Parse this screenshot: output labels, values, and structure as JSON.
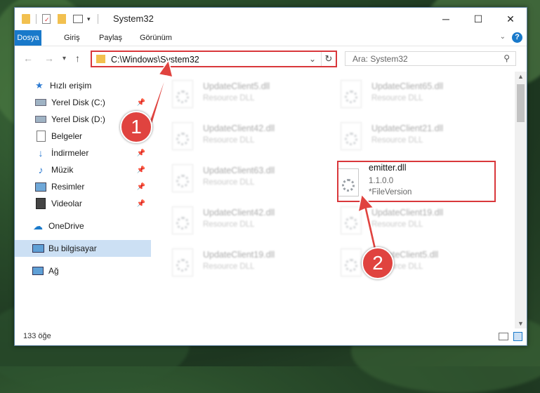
{
  "window": {
    "title": "System32",
    "minimize_label": "─",
    "maximize_label": "☐",
    "close_label": "✕"
  },
  "ribbon": {
    "tabs": [
      "Dosya",
      "Giriş",
      "Paylaş",
      "Görünüm"
    ]
  },
  "nav": {
    "address": "C:\\Windows\\System32",
    "search_placeholder": "Ara: System32"
  },
  "sidebar": {
    "items": [
      {
        "label": "Hızlı erişim",
        "icon": "star-icon",
        "pinned": false
      },
      {
        "label": "Yerel Disk (C:)",
        "icon": "drive-icon",
        "pinned": true
      },
      {
        "label": "Yerel Disk (D:)",
        "icon": "drive-icon",
        "pinned": true
      },
      {
        "label": "Belgeler",
        "icon": "documents-icon",
        "pinned": true
      },
      {
        "label": "İndirmeler",
        "icon": "download-icon",
        "pinned": true
      },
      {
        "label": "Müzik",
        "icon": "music-icon",
        "pinned": true
      },
      {
        "label": "Resimler",
        "icon": "pictures-icon",
        "pinned": true
      },
      {
        "label": "Videolar",
        "icon": "videos-icon",
        "pinned": true
      },
      {
        "label": "OneDrive",
        "icon": "cloud-icon",
        "pinned": false
      },
      {
        "label": "Bu bilgisayar",
        "icon": "computer-icon",
        "pinned": false,
        "selected": true
      },
      {
        "label": "Ağ",
        "icon": "network-icon",
        "pinned": false
      }
    ]
  },
  "files": [
    {
      "name": "UpdateClient5.dll",
      "type": "Resource DLL"
    },
    {
      "name": "UpdateClient65.dll",
      "type": "Resource DLL"
    },
    {
      "name": "UpdateClient42.dll",
      "type": "Resource DLL"
    },
    {
      "name": "UpdateClient21.dll",
      "type": "Resource DLL"
    },
    {
      "name": "UpdateClient63.dll",
      "type": "Resource DLL"
    },
    {
      "name": "emitter.dll",
      "version": "1.1.0.0",
      "description": "*FileVersion"
    },
    {
      "name": "UpdateClient42.dll",
      "type": "Resource DLL"
    },
    {
      "name": "UpdateClient19.dll",
      "type": "Resource DLL"
    },
    {
      "name": "UpdateClient19.dll",
      "type": "Resource DLL"
    },
    {
      "name": "UpdateClient5.dll",
      "type": "Resource DLL"
    }
  ],
  "status": {
    "count": "133 öğe"
  },
  "annotations": {
    "step1": "1",
    "step2": "2",
    "color": "#d9373b"
  }
}
